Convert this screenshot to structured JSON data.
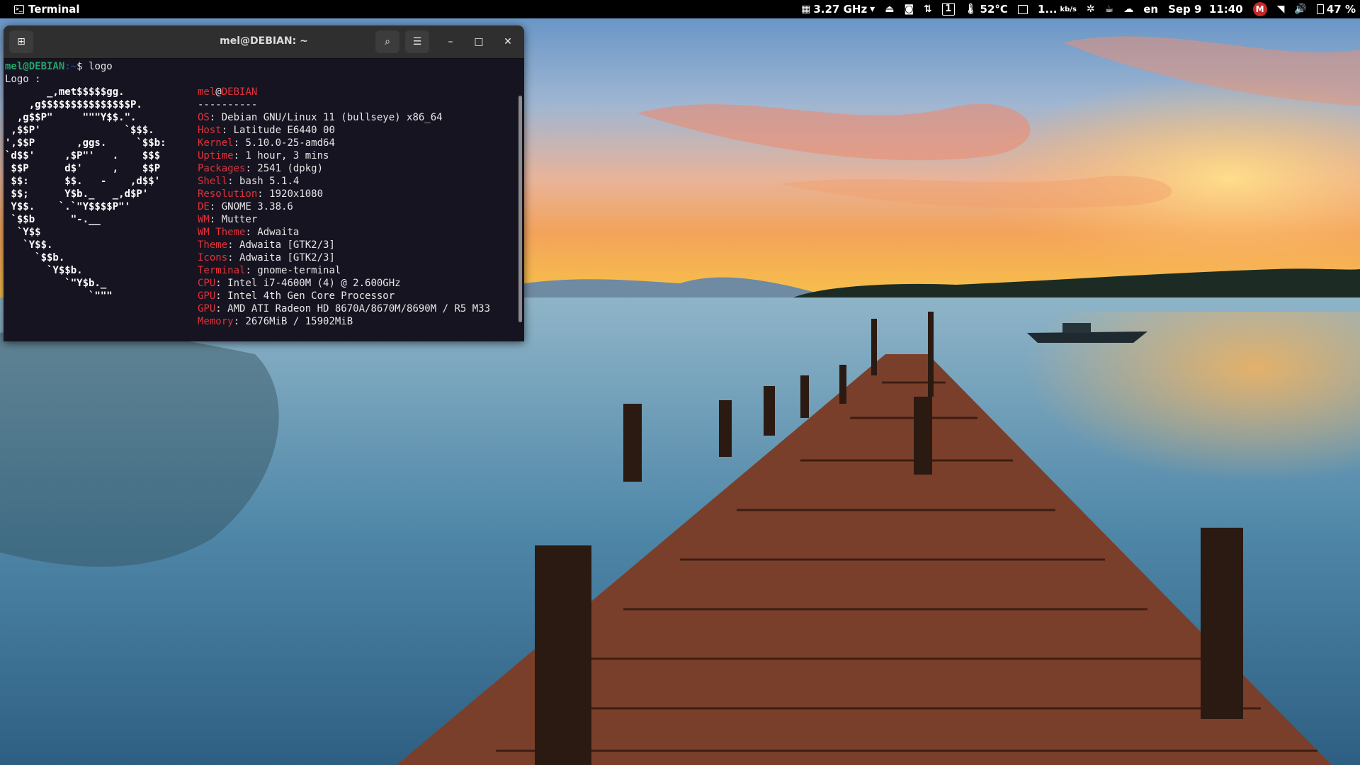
{
  "topbar": {
    "app_name": "Terminal",
    "cpu_freq": "3.27 GHz",
    "workspace": "1",
    "temperature": "52°C",
    "net_speed": "1...",
    "net_unit": "kb/s",
    "keyboard_layout": "en",
    "datetime": "Sep 9  11:40",
    "mail_badge": "M",
    "battery": "47 %"
  },
  "terminal": {
    "title": "mel@DEBIAN: ~",
    "prompt_user": "mel@DEBIAN",
    "prompt_path": ":~",
    "prompt_symbol": "$ ",
    "command": "logo",
    "output_first_line": "Logo :",
    "ascii_logo": [
      "       _,met$$$$$gg.",
      "    ,g$$$$$$$$$$$$$$$P.",
      "  ,g$$P\"     \"\"\"Y$$.\".",
      " ,$$P'              `$$$.",
      "',$$P       ,ggs.     `$$b:",
      "`d$$'     ,$P\"'   .    $$$",
      " $$P      d$'     ,    $$P",
      " $$:      $$.   -    ,d$$'",
      " $$;      Y$b._   _,d$P'",
      " Y$$.    `.`\"Y$$$$P\"'",
      " `$$b      \"-.__",
      "  `Y$$",
      "   `Y$$.",
      "     `$$b.",
      "       `Y$$b.",
      "          `\"Y$b._",
      "              `\"\"\""
    ],
    "header_user": "mel",
    "header_at": "@",
    "header_host": "DEBIAN",
    "separator": "----------",
    "info": [
      {
        "key": "OS",
        "value": "Debian GNU/Linux 11 (bullseye) x86_64"
      },
      {
        "key": "Host",
        "value": "Latitude E6440 00"
      },
      {
        "key": "Kernel",
        "value": "5.10.0-25-amd64"
      },
      {
        "key": "Uptime",
        "value": "1 hour, 3 mins"
      },
      {
        "key": "Packages",
        "value": "2541 (dpkg)"
      },
      {
        "key": "Shell",
        "value": "bash 5.1.4"
      },
      {
        "key": "Resolution",
        "value": "1920x1080"
      },
      {
        "key": "DE",
        "value": "GNOME 3.38.6"
      },
      {
        "key": "WM",
        "value": "Mutter"
      },
      {
        "key": "WM Theme",
        "value": "Adwaita"
      },
      {
        "key": "Theme",
        "value": "Adwaita [GTK2/3]"
      },
      {
        "key": "Icons",
        "value": "Adwaita [GTK2/3]"
      },
      {
        "key": "Terminal",
        "value": "gnome-terminal"
      },
      {
        "key": "CPU",
        "value": "Intel i7-4600M (4) @ 2.600GHz"
      },
      {
        "key": "GPU",
        "value": "Intel 4th Gen Core Processor"
      },
      {
        "key": "GPU",
        "value": "AMD ATI Radeon HD 8670A/8670M/8690M / R5 M33"
      },
      {
        "key": "Memory",
        "value": "2676MiB / 15902MiB"
      }
    ],
    "palette": [
      "#171421",
      "#c01c28",
      "#26a269",
      "#a2734c",
      "#12488b",
      "#a347ba",
      "#2aa1b3",
      "#d0cfcc"
    ]
  }
}
